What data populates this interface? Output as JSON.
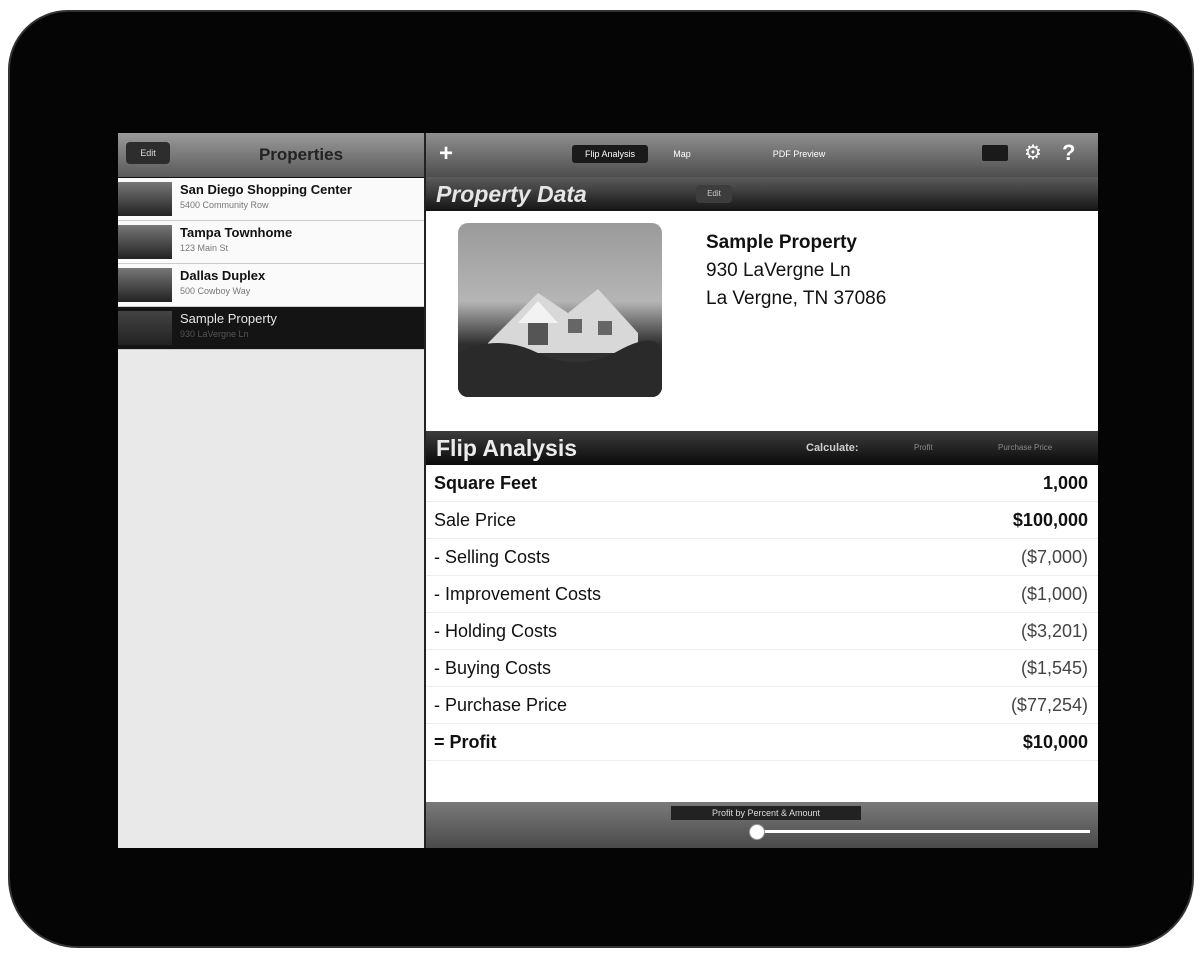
{
  "sidebar": {
    "edit_label": "Edit",
    "title": "Properties",
    "items": [
      {
        "name": "San Diego Shopping Center",
        "address": "5400 Community Row"
      },
      {
        "name": "Tampa Townhome",
        "address": "123 Main St"
      },
      {
        "name": "Dallas Duplex",
        "address": "500 Cowboy Way"
      },
      {
        "name": "Sample Property",
        "address": "930 LaVergne Ln"
      }
    ]
  },
  "toolbar": {
    "add_label": "+",
    "tabs": [
      "Flip Analysis",
      "Map",
      "PDF Preview"
    ],
    "help_label": "?"
  },
  "property_data": {
    "title": "Property Data",
    "edit_label": "Edit",
    "name": "Sample Property",
    "street": "930 LaVergne Ln",
    "city": "La Vergne, TN 37086"
  },
  "flip_analysis": {
    "title": "Flip Analysis",
    "calculate_label": "Calculate:",
    "options": [
      "Profit",
      "Purchase Price"
    ],
    "rows": [
      {
        "label": "Square Feet",
        "value": "1,000"
      },
      {
        "label": "Sale Price",
        "value": "$100,000"
      },
      {
        "label": "- Selling Costs",
        "value": "($7,000)"
      },
      {
        "label": "- Improvement Costs",
        "value": "($1,000)"
      },
      {
        "label": "- Holding Costs",
        "value": "($3,201)"
      },
      {
        "label": "- Buying Costs",
        "value": "($1,545)"
      },
      {
        "label": "- Purchase Price",
        "value": "($77,254)"
      },
      {
        "label": "= Profit",
        "value": "$10,000"
      }
    ]
  },
  "footer": {
    "label": "Profit by Percent & Amount"
  }
}
